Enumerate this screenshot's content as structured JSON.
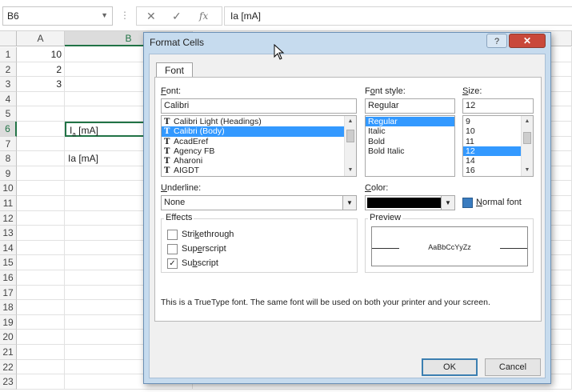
{
  "formula_bar": {
    "name_box": "B6",
    "cancel_icon": "✕",
    "enter_icon": "✓",
    "fx_icon": "fx",
    "content": "Ia [mA]"
  },
  "sheet": {
    "columns": [
      "A",
      "B"
    ],
    "rows": [
      "1",
      "2",
      "3",
      "4",
      "5",
      "6",
      "7",
      "8",
      "9",
      "10",
      "11",
      "12",
      "13",
      "14",
      "15",
      "16",
      "17",
      "18",
      "19",
      "20",
      "21",
      "22",
      "23"
    ],
    "cells": {
      "A1": "10",
      "A2": "2",
      "A3": "3",
      "B6_base": "I",
      "B6_sub": "a",
      "B6_rest": " [mA]",
      "B8": "Ia [mA]"
    }
  },
  "dialog": {
    "title": "Format Cells",
    "help_label": "?",
    "close_label": "✕",
    "tab": "Font",
    "font_label_key": "F",
    "font_label_rest": "ont:",
    "font_value": "Calibri",
    "font_list": [
      "Calibri Light (Headings)",
      "Calibri (Body)",
      "AcadEref",
      "Agency FB",
      "Aharoni",
      "AIGDT"
    ],
    "font_selected_index": 1,
    "style_label_pre": "F",
    "style_label_key": "o",
    "style_label_rest": "nt style:",
    "style_value": "Regular",
    "style_list": [
      "Regular",
      "Italic",
      "Bold",
      "Bold Italic"
    ],
    "size_label_key": "S",
    "size_label_rest": "ize:",
    "size_value": "12",
    "size_list": [
      "9",
      "10",
      "11",
      "12",
      "14",
      "16"
    ],
    "underline_label_key": "U",
    "underline_label_rest": "nderline:",
    "underline_value": "None",
    "color_label_key": "C",
    "color_label_rest": "olor:",
    "normal_font_key": "N",
    "normal_font_rest": "ormal font",
    "effects_title": "Effects",
    "strike_pre": "Stri",
    "strike_key": "k",
    "strike_rest": "ethrough",
    "super_pre": "Sup",
    "super_key": "e",
    "super_rest": "rscript",
    "sub_pre": "Su",
    "sub_key": "b",
    "sub_rest": "script",
    "strikethrough_checked": false,
    "superscript_checked": false,
    "subscript_checked": true,
    "preview_title": "Preview",
    "preview_text": "AaBbCcYyZz",
    "info_text": "This is a TrueType font.  The same font will be used on both your printer and your screen.",
    "ok_label": "OK",
    "cancel_label": "Cancel",
    "color_value": "#000000"
  }
}
